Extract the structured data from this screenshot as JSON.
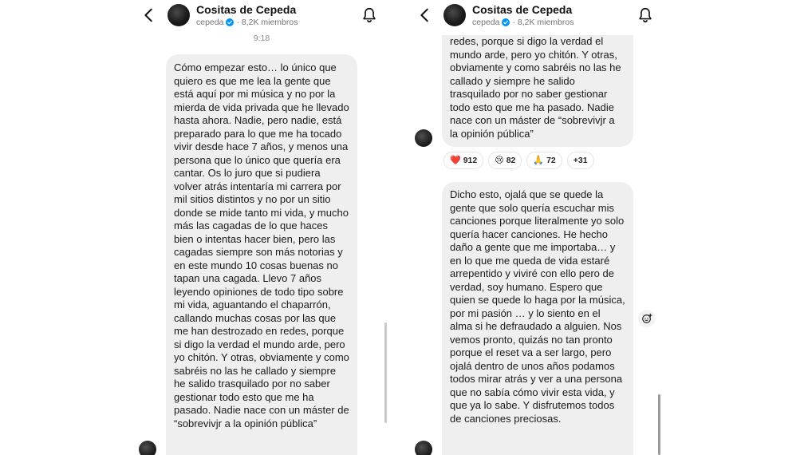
{
  "colors": {
    "bubble": "#efefef",
    "verified": "#0095f6",
    "heart": "#e0245e"
  },
  "left": {
    "header": {
      "title": "Cositas de Cepeda",
      "handle": "cepeda",
      "members": "8,2K miembros"
    },
    "timestamp": "9:18",
    "message": "Cómo empezar esto… lo único que quiero es que me lea la gente que está aquí por mi música y no por la mierda de vida privada que he llevado hasta ahora. Nadie, pero nadie, está preparado para lo que me ha tocado vivir desde hace 7 años, y menos una persona que lo único que quería era cantar. Os lo juro que si pudiera volver atrás intentaría mi carrera por mil sitios distintos y no por un sitio donde se mide tanto mi vida, y mucho más las cagadas de lo que haces bien o intentas hacer bien, pero las cagadas siempre son más notorias y en este mundo 10 cosas buenas no tapan una cagada. Llevo 7 años leyendo opiniones de todo tipo sobre mi vida, aguantando el chaparrón, callando muchas cosas por las que me han destrozado en redes, porque si digo la verdad el mundo arde, pero yo chitón. Y otras, obviamente y como sabréis no las he callado y siempre he salido trasquilado por no saber gestionar todo esto que me ha pasado. Nadie nace con un máster de “sobrevivjr a la opinión pública”"
  },
  "right": {
    "header": {
      "title": "Cositas de Cepeda",
      "handle": "cepeda",
      "members": "8,2K miembros"
    },
    "message1_clipped": "redes, porque si digo la verdad el",
    "message1": "mundo arde, pero yo chitón. Y otras, obviamente y como sabréis no las he callado y siempre he salido trasquilado por no saber gestionar todo esto que me ha pasado. Nadie nace con un máster de “sobrevivjr a la opinión pública”",
    "reactions": [
      {
        "icon": "heart-icon",
        "emoji": "❤️",
        "count": "912"
      },
      {
        "icon": "sad-face-icon",
        "emoji": "😢",
        "count": "82"
      },
      {
        "icon": "folded-hands-icon",
        "emoji": "🙏",
        "count": "72"
      },
      {
        "icon": "",
        "emoji": "",
        "count": "+31"
      }
    ],
    "message2": "Dicho esto, ojalá que se quede la gente que solo quería escuchar mis canciones porque literalmente yo solo quería hacer canciones. He hecho daño a gente que me importaba… y en lo que me queda de vida estaré arrepentido y viviré con ello pero de verdad, soy humano. Espero que quien se quede lo haga por la música, por mi pasión … y lo siento en el alma si he defraudado a alguien. Nos vemos pronto, quizás no tan pronto porque el reset va a ser largo, pero ojalá dentro de unos años podamos todos mirar atrás y ver a una persona que no sabía cómo vivir esta vida, y que ya lo sabe. Y disfrutemos todos de canciones preciosas."
  }
}
